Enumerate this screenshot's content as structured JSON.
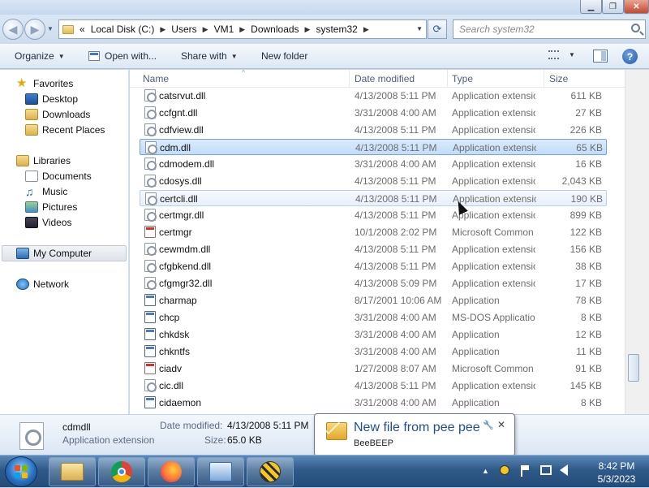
{
  "window": {
    "min_glyph": "▁",
    "max_glyph": "❐",
    "close_glyph": "✕"
  },
  "nav": {
    "back_glyph": "◀",
    "forward_glyph": "▶",
    "recent_glyph": "▼",
    "address_prefix": "«",
    "breadcrumb": [
      "Local Disk (C:)",
      "Users",
      "VM1",
      "Downloads",
      "system32"
    ],
    "crumb_separator": "▶",
    "refresh_glyph": "⟳",
    "search_placeholder": "Search system32"
  },
  "toolbar": {
    "organize": "Organize",
    "open_with": "Open with...",
    "share_with": "Share with",
    "new_folder": "New folder",
    "caret": "▼",
    "help": "?"
  },
  "sidebar": {
    "favorites": {
      "label": "Favorites",
      "items": [
        "Desktop",
        "Downloads",
        "Recent Places"
      ]
    },
    "libraries": {
      "label": "Libraries",
      "items": [
        "Documents",
        "Music",
        "Pictures",
        "Videos"
      ]
    },
    "computer": "My Computer",
    "network": "Network"
  },
  "columns": {
    "name": "Name",
    "date": "Date modified",
    "type": "Type",
    "size": "Size",
    "sort_glyph": "^"
  },
  "files": [
    {
      "name": "catsrvut.dll",
      "date": "4/13/2008 5:11 PM",
      "type": "Application extension",
      "size": "611 KB",
      "icon": "dll"
    },
    {
      "name": "ccfgnt.dll",
      "date": "3/31/2008 4:00 AM",
      "type": "Application extension",
      "size": "27 KB",
      "icon": "dll"
    },
    {
      "name": "cdfview.dll",
      "date": "4/13/2008 5:11 PM",
      "type": "Application extension",
      "size": "226 KB",
      "icon": "dll"
    },
    {
      "name": "cdm.dll",
      "date": "4/13/2008 5:11 PM",
      "type": "Application extension",
      "size": "65 KB",
      "icon": "dll"
    },
    {
      "name": "cdmodem.dll",
      "date": "3/31/2008 4:00 AM",
      "type": "Application extension",
      "size": "16 KB",
      "icon": "dll"
    },
    {
      "name": "cdosys.dll",
      "date": "4/13/2008 5:11 PM",
      "type": "Application extension",
      "size": "2,043 KB",
      "icon": "dll"
    },
    {
      "name": "certcli.dll",
      "date": "4/13/2008 5:11 PM",
      "type": "Application extension",
      "size": "190 KB",
      "icon": "dll"
    },
    {
      "name": "certmgr.dll",
      "date": "4/13/2008 5:11 PM",
      "type": "Application extension",
      "size": "899 KB",
      "icon": "dll"
    },
    {
      "name": "certmgr",
      "date": "10/1/2008 2:02 PM",
      "type": "Microsoft Common C...",
      "size": "122 KB",
      "icon": "msc"
    },
    {
      "name": "cewmdm.dll",
      "date": "4/13/2008 5:11 PM",
      "type": "Application extension",
      "size": "156 KB",
      "icon": "dll"
    },
    {
      "name": "cfgbkend.dll",
      "date": "4/13/2008 5:11 PM",
      "type": "Application extension",
      "size": "38 KB",
      "icon": "dll"
    },
    {
      "name": "cfgmgr32.dll",
      "date": "4/13/2008 5:09 PM",
      "type": "Application extension",
      "size": "17 KB",
      "icon": "dll"
    },
    {
      "name": "charmap",
      "date": "8/17/2001 10:06 AM",
      "type": "Application",
      "size": "78 KB",
      "icon": "app"
    },
    {
      "name": "chcp",
      "date": "3/31/2008 4:00 AM",
      "type": "MS-DOS Application",
      "size": "8 KB",
      "icon": "app"
    },
    {
      "name": "chkdsk",
      "date": "3/31/2008 4:00 AM",
      "type": "Application",
      "size": "12 KB",
      "icon": "app"
    },
    {
      "name": "chkntfs",
      "date": "3/31/2008 4:00 AM",
      "type": "Application",
      "size": "11 KB",
      "icon": "app"
    },
    {
      "name": "ciadv",
      "date": "1/27/2008 8:07 AM",
      "type": "Microsoft Common C...",
      "size": "91 KB",
      "icon": "msc"
    },
    {
      "name": "cic.dll",
      "date": "4/13/2008 5:11 PM",
      "type": "Application extension",
      "size": "145 KB",
      "icon": "dll"
    },
    {
      "name": "cidaemon",
      "date": "3/31/2008 4:00 AM",
      "type": "Application",
      "size": "8 KB",
      "icon": "app"
    }
  ],
  "selected_index": 3,
  "hover_index": 6,
  "details": {
    "name": "cdmdll",
    "type": "Application extension",
    "date_label": "Date modified:",
    "date_value": "4/13/2008 5:11 PM",
    "size_label": "Size:",
    "size_value": "65.0 KB"
  },
  "notification": {
    "title": "New file from pee pee",
    "app": "BeeBEEP",
    "pin_glyph": "🔧",
    "close_glyph": "✕"
  },
  "taskbar": {
    "apps": [
      "file-explorer",
      "chrome",
      "firefox",
      "control-panel",
      "beebeep"
    ],
    "tray_expand": "▲",
    "time": "8:42 PM",
    "date": "5/3/2023"
  }
}
